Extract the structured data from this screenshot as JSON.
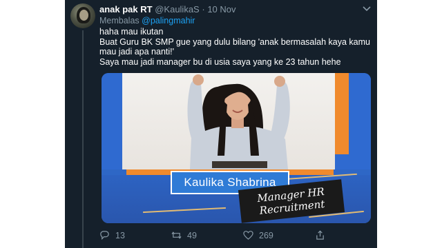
{
  "tweet": {
    "author_name": "anak pak RT",
    "author_handle": "@KaulikaS",
    "separator": "·",
    "date": "10 Nov",
    "reply_prefix": "Membalas",
    "reply_mention": "@palingmahir",
    "body_lines": [
      "haha mau ikutan",
      "Buat Guru BK SMP gue yang dulu bilang 'anak bermasalah kaya kamu mau jadi apa nanti!'",
      "Saya mau jadi manager bu di usia saya yang ke 23 tahun hehe"
    ]
  },
  "image": {
    "name_card": "Kaulika Shabrina",
    "title_line1": "Manager HR",
    "title_line2": "Recruitment"
  },
  "actions": {
    "reply_icon": "reply-icon",
    "reply_count": "13",
    "retweet_icon": "retweet-icon",
    "retweet_count": "49",
    "like_icon": "heart-icon",
    "like_count": "269",
    "share_icon": "share-icon"
  },
  "colors": {
    "background": "#15202b",
    "text": "#ffffff",
    "muted": "#8899a6",
    "accent": "#1da1f2"
  }
}
